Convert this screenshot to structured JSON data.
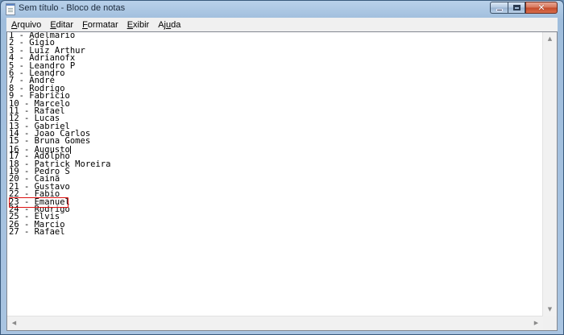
{
  "window": {
    "title": "Sem título - Bloco de notas",
    "caption": {
      "minimize": "minimize",
      "maximize": "maximize",
      "close": "✕"
    }
  },
  "menu": [
    {
      "pre": "",
      "u": "A",
      "post": "rquivo"
    },
    {
      "pre": "",
      "u": "E",
      "post": "ditar"
    },
    {
      "pre": "",
      "u": "F",
      "post": "ormatar"
    },
    {
      "pre": "",
      "u": "E",
      "post": "xibir"
    },
    {
      "pre": "Aj",
      "u": "u",
      "post": "da"
    }
  ],
  "document": {
    "lines": [
      "1 - Adelmario",
      "2 - Gigio",
      "3 - Luiz Arthur",
      "4 - Adrianofx",
      "5 - Leandro P",
      "6 - Leandro",
      "7 - André",
      "8 - Rodrigo",
      "9 - Fabricio",
      "10 - Marcelo",
      "11 - Rafael",
      "12 - Lucas",
      "13 - Gabriel",
      "14 - Joao Carlos",
      "15 - Bruna Gomes",
      "16 - Augusto",
      "17 - Adolpho",
      "18 - Patrick Moreira",
      "19 - Pedro S",
      "20 - Cainã",
      "21 - Gustavo",
      "22 - Fabio",
      "23 - Emanuel",
      "24 - Rodrigo",
      "25 - Elvis",
      "26 - Marcio",
      "27 - Rafael"
    ],
    "caret_line": 16,
    "highlighted_line": 23
  },
  "colors": {
    "highlight": "#dd1111",
    "window_frame": "#a9c4e1"
  },
  "scrollbar": {
    "up_icon": "▲",
    "down_icon": "▼",
    "left_icon": "◀",
    "right_icon": "▶"
  }
}
